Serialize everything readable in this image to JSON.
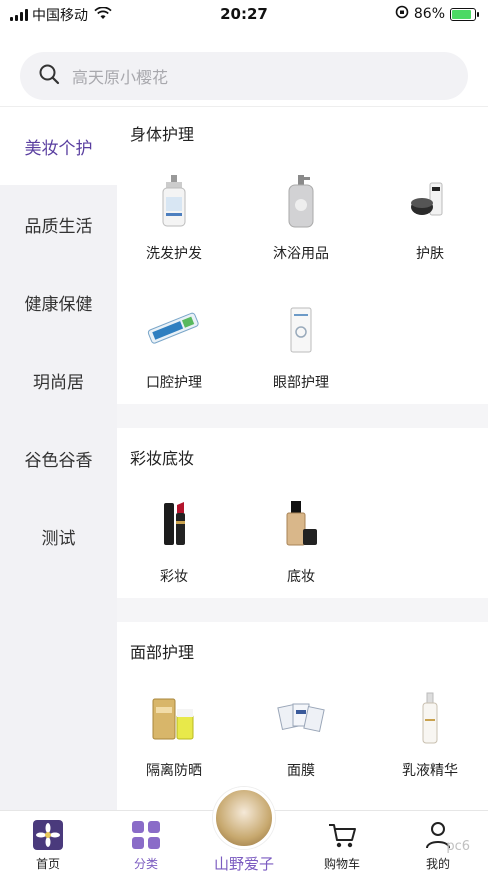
{
  "status_bar": {
    "carrier": "中国移动",
    "time": "20:27",
    "battery_percent": "86%",
    "battery_level": 0.86
  },
  "search": {
    "placeholder": "高天原小樱花"
  },
  "sidebar": {
    "items": [
      {
        "label": "美妆个护",
        "active": true
      },
      {
        "label": "品质生活",
        "active": false
      },
      {
        "label": "健康保健",
        "active": false
      },
      {
        "label": "玥尚居",
        "active": false
      },
      {
        "label": "谷色谷香",
        "active": false
      },
      {
        "label": "测试",
        "active": false
      }
    ]
  },
  "sections": [
    {
      "title": "身体护理",
      "products": [
        {
          "label": "洗发护发",
          "icon": "shampoo-bottle-icon"
        },
        {
          "label": "沐浴用品",
          "icon": "bodywash-bottle-icon"
        },
        {
          "label": "护肤",
          "icon": "skincare-jar-icon"
        },
        {
          "label": "口腔护理",
          "icon": "toothpaste-icon"
        },
        {
          "label": "眼部护理",
          "icon": "eye-cream-icon"
        }
      ]
    },
    {
      "title": "彩妆底妆",
      "products": [
        {
          "label": "彩妆",
          "icon": "lipstick-icon"
        },
        {
          "label": "底妆",
          "icon": "foundation-bottle-icon"
        }
      ]
    },
    {
      "title": "面部护理",
      "products": [
        {
          "label": "隔离防晒",
          "icon": "sunscreen-icon"
        },
        {
          "label": "面膜",
          "icon": "face-mask-icon"
        },
        {
          "label": "乳液精华",
          "icon": "serum-bottle-icon"
        }
      ]
    }
  ],
  "tabbar": {
    "tabs": [
      {
        "label": "首页",
        "icon": "home-flower-icon",
        "active": false
      },
      {
        "label": "分类",
        "icon": "category-grid-icon",
        "active": true
      },
      {
        "label": "山野爱子",
        "icon": "brand-badge-icon",
        "active": false
      },
      {
        "label": "购物车",
        "icon": "cart-icon",
        "active": false
      },
      {
        "label": "我的",
        "icon": "profile-icon",
        "active": false
      }
    ]
  },
  "colors": {
    "accent": "#7b5bc0",
    "active_sidebar_text": "#5a3fa0",
    "sidebar_bg": "#f2f2f5"
  },
  "watermark": "pc6"
}
